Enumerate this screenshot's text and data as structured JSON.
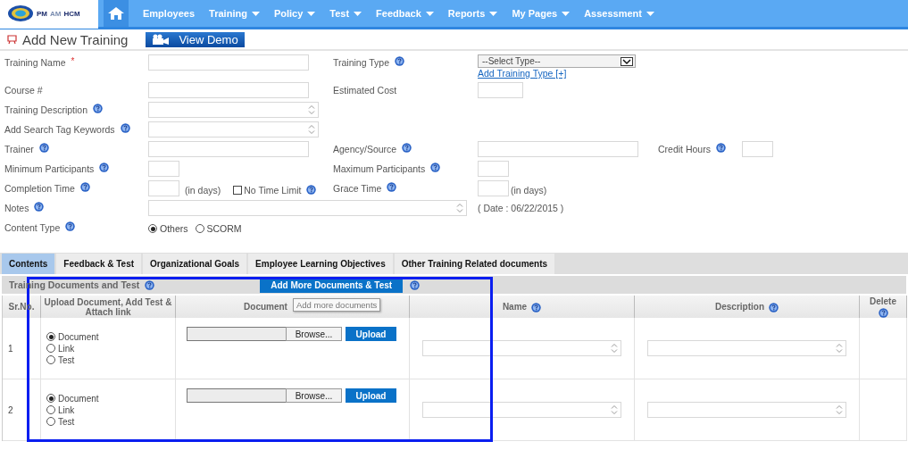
{
  "header": {
    "logo": [
      "PM",
      "AM",
      "HCM"
    ],
    "nav": [
      {
        "label": "Employees",
        "dropdown": false
      },
      {
        "label": "Training",
        "dropdown": true
      },
      {
        "label": "Policy",
        "dropdown": true
      },
      {
        "label": "Test",
        "dropdown": true
      },
      {
        "label": "Feedback",
        "dropdown": true
      },
      {
        "label": "Reports",
        "dropdown": true
      },
      {
        "label": "My Pages",
        "dropdown": true
      },
      {
        "label": "Assessment",
        "dropdown": true
      }
    ]
  },
  "page": {
    "title": "Add New Training",
    "demo_button": "View Demo"
  },
  "form": {
    "training_name": {
      "label": "Training Name",
      "required_mark": "*"
    },
    "training_type": {
      "label": "Training Type",
      "help": true,
      "select": "--Select Type--",
      "link": "Add Training Type [+]"
    },
    "course": {
      "label": "Course #"
    },
    "estimated_cost": {
      "label": "Estimated Cost"
    },
    "description": {
      "label": "Training Description",
      "help": true
    },
    "tags": {
      "label": "Add Search Tag Keywords",
      "help": true
    },
    "trainer": {
      "label": "Trainer",
      "help": true
    },
    "agency": {
      "label": "Agency/Source",
      "help": true
    },
    "credit_hours": {
      "label": "Credit Hours",
      "help": true
    },
    "min_participants": {
      "label": "Minimum Participants",
      "help": true
    },
    "max_participants": {
      "label": "Maximum Participants",
      "help": true
    },
    "completion_time": {
      "label": "Completion Time",
      "help": true,
      "unit": "(in days)",
      "no_limit": {
        "label": "No Time Limit",
        "checked": false,
        "help": true
      }
    },
    "grace_time": {
      "label": "Grace Time",
      "help": true,
      "unit": "(in days)"
    },
    "notes": {
      "label": "Notes",
      "help": true,
      "date": "( Date : 06/22/2015 )"
    },
    "content_type": {
      "label": "Content Type",
      "help": true,
      "options": [
        {
          "label": "Others",
          "selected": true
        },
        {
          "label": "SCORM",
          "selected": false
        }
      ]
    }
  },
  "tabs": [
    {
      "label": "Contents",
      "selected": true
    },
    {
      "label": "Feedback & Test",
      "selected": false
    },
    {
      "label": "Organizational Goals",
      "selected": false
    },
    {
      "label": "Employee Learning Objectives",
      "selected": false
    },
    {
      "label": "Other Training Related documents",
      "selected": false
    }
  ],
  "section": {
    "title": "Training Documents and Test",
    "help": true,
    "button": "Add More Documents & Test",
    "button_help": true,
    "tooltip": "Add more documents"
  },
  "table": {
    "columns": [
      {
        "label": "Sr.No."
      },
      {
        "label": "Upload Document, Add Test & Attach link"
      },
      {
        "label": "Document"
      },
      {
        "label": "Name",
        "help": true
      },
      {
        "label": "Description",
        "help": true
      },
      {
        "label": "Delete",
        "help": true
      }
    ],
    "rows": [
      {
        "sr": "1",
        "options": [
          {
            "label": "Document",
            "selected": true
          },
          {
            "label": "Link",
            "selected": false
          },
          {
            "label": "Test",
            "selected": false
          }
        ],
        "browse": "Browse...",
        "upload": "Upload"
      },
      {
        "sr": "2",
        "options": [
          {
            "label": "Document",
            "selected": true
          },
          {
            "label": "Link",
            "selected": false
          },
          {
            "label": "Test",
            "selected": false
          }
        ],
        "browse": "Browse...",
        "upload": "Upload"
      }
    ]
  },
  "highlight": true
}
